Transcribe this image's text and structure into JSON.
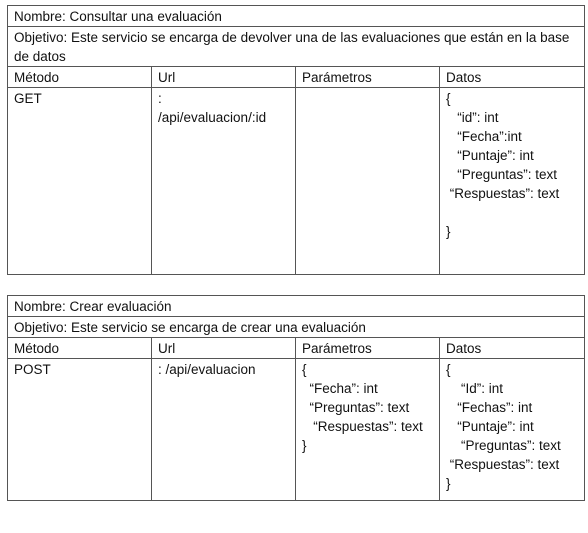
{
  "services": [
    {
      "nombre": "Nombre:  Consultar una evaluación",
      "objetivo": "Objetivo: Este servicio se encarga de devolver una de las evaluaciones que están en la base de datos",
      "headers": {
        "metodo": "Método",
        "url": "Url",
        "parametros": "Parámetros",
        "datos": "Datos"
      },
      "metodo": "GET",
      "url_lines": [
        ":",
        "/api/evaluacion/:id"
      ],
      "parametros_lines": [],
      "datos_lines": [
        "{",
        "   “id”: int",
        "   “Fecha”:int",
        "   “Puntaje”: int",
        "   “Preguntas”: text",
        " “Respuestas”: text",
        "",
        "}"
      ]
    },
    {
      "nombre": "Nombre:  Crear evaluación",
      "objetivo": "Objetivo: Este servicio se encarga de crear una evaluación",
      "headers": {
        "metodo": "Método",
        "url": "Url",
        "parametros": "Parámetros",
        "datos": "Datos"
      },
      "metodo": "POST",
      "url_lines": [
        ": /api/evaluacion"
      ],
      "parametros_lines": [
        "{",
        "  “Fecha”: int",
        "  “Preguntas”: text",
        "   “Respuestas”: text",
        "}"
      ],
      "datos_lines": [
        "{",
        "    “Id”: int",
        "   “Fechas”: int",
        "   “Puntaje”: int",
        "    “Preguntas”: text",
        " “Respuestas”: text",
        "}"
      ]
    }
  ]
}
